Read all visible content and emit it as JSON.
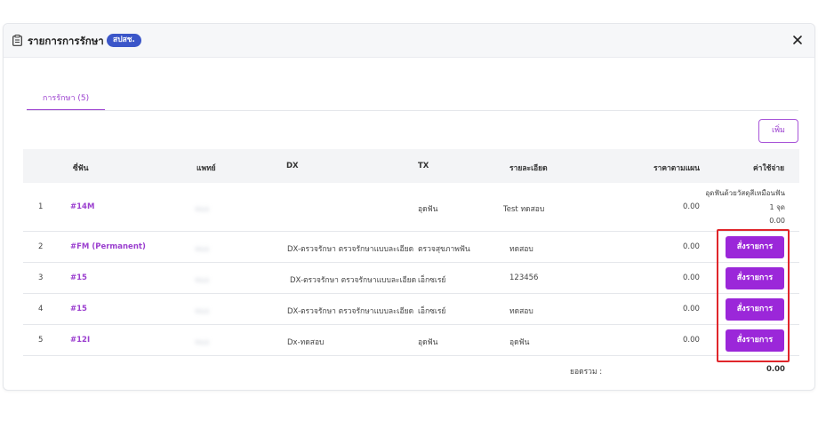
{
  "modal": {
    "title": "รายการการรักษา",
    "badge": "สปสช."
  },
  "tabs": [
    {
      "label": "การรักษา (5)"
    }
  ],
  "add_button": "เพิ่ม",
  "table": {
    "headers": [
      "ซี่ฟัน",
      "แพทย์",
      "DX",
      "TX",
      "รายละเอียด",
      "ราคาตามแผน",
      "ค่าใช้จ่าย"
    ],
    "rows": [
      {
        "no": "1",
        "tooth": "#14M",
        "doctor": "หมอ",
        "dx": "",
        "tx": "อุดฟัน",
        "detail": "Test ทดสอบ",
        "price": "0.00",
        "cost_lines": [
          "อุดฟันด้วยวัสดุสีเหมือนฟัน",
          "1 จุด",
          "0.00"
        ]
      },
      {
        "no": "2",
        "tooth": "#FM (Permanent)",
        "doctor": "หมอ",
        "dx": "DX-ตรวจรักษา ตรวจรักษาแบบละเอียด",
        "tx": "ตรวจสุขภาพฟัน",
        "detail": "ทดสอบ",
        "price": "0.00",
        "button": "สั่งรายการ"
      },
      {
        "no": "3",
        "tooth": "#15",
        "doctor": "หมอ",
        "dx": "DX-ตรวจรักษา ตรวจรักษาแบบละเอียด",
        "tx": "เอ็กซเรย์",
        "detail": "123456",
        "price": "0.00",
        "button": "สั่งรายการ"
      },
      {
        "no": "4",
        "tooth": "#15",
        "doctor": "หมอ",
        "dx": "DX-ตรวจรักษา ตรวจรักษาแบบละเอียด",
        "tx": "เอ็กซเรย์",
        "detail": "ทดสอบ",
        "price": "0.00",
        "button": "สั่งรายการ"
      },
      {
        "no": "5",
        "tooth": "#12I",
        "doctor": "หมอ",
        "dx": "Dx-ทดสอบ",
        "tx": "อุดฟัน",
        "detail": "อุดฟัน",
        "price": "0.00",
        "button": "สั่งรายการ"
      }
    ],
    "total_label": "ยอดรวม :",
    "total_value": "0.00"
  },
  "icons": {
    "header": "clipboard-icon",
    "close": "close-icon"
  },
  "colors": {
    "accent": "#9b27d9",
    "badge": "#3b56c9",
    "highlight": "#e0262b"
  }
}
